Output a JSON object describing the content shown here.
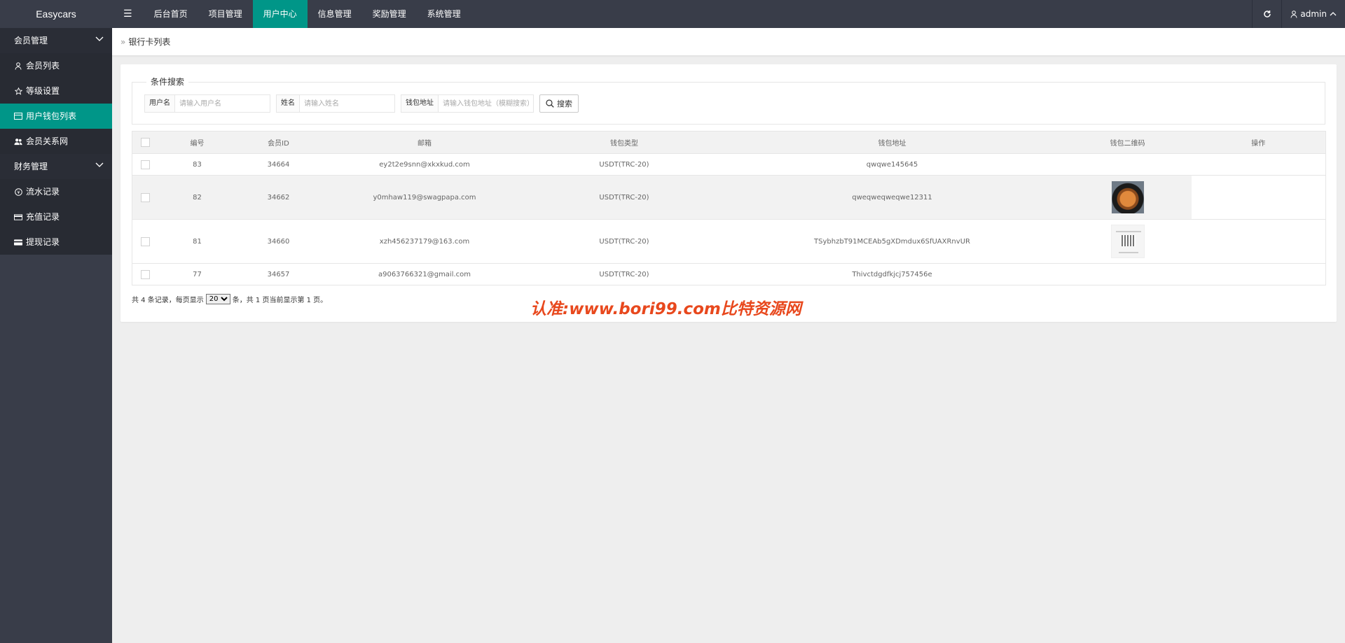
{
  "app": {
    "title": "Easycars"
  },
  "topnav": {
    "toggle": "☰",
    "items": [
      {
        "label": "后台首页"
      },
      {
        "label": "项目管理"
      },
      {
        "label": "用户中心",
        "active": true
      },
      {
        "label": "信息管理"
      },
      {
        "label": "奖励管理"
      },
      {
        "label": "系统管理"
      }
    ],
    "user": "admin"
  },
  "sidebar": {
    "group1": {
      "label": "会员管理"
    },
    "items1": [
      {
        "label": "会员列表",
        "icon": "user-icon"
      },
      {
        "label": "等级设置",
        "icon": "star-icon"
      },
      {
        "label": "用户钱包列表",
        "icon": "card-icon",
        "active": true
      },
      {
        "label": "会员关系网",
        "icon": "users-icon"
      }
    ],
    "group2": {
      "label": "财务管理"
    },
    "items2": [
      {
        "label": "流水记录",
        "icon": "coin-icon"
      },
      {
        "label": "充值记录",
        "icon": "card-icon"
      },
      {
        "label": "提现记录",
        "icon": "card-icon"
      }
    ]
  },
  "breadcrumb": {
    "sep": "»",
    "current": "银行卡列表"
  },
  "search": {
    "legend": "条件搜索",
    "username": {
      "label": "用户名",
      "placeholder": "请输入用户名"
    },
    "name": {
      "label": "姓名",
      "placeholder": "请输入姓名"
    },
    "wallet": {
      "label": "钱包地址",
      "placeholder": "请输入钱包地址（模糊搜索）"
    },
    "button": "搜索"
  },
  "table": {
    "headers": [
      "编号",
      "会员ID",
      "邮箱",
      "钱包类型",
      "钱包地址",
      "钱包二维码",
      "操作"
    ],
    "rows": [
      {
        "id": "83",
        "member_id": "34664",
        "email": "ey2t2e9snn@xkxkud.com",
        "type": "USDT(TRC-20)",
        "address": "qwqwe145645",
        "qr": ""
      },
      {
        "id": "82",
        "member_id": "34662",
        "email": "y0mhaw119@swagpapa.com",
        "type": "USDT(TRC-20)",
        "address": "qweqweqweqwe12311",
        "qr": "food"
      },
      {
        "id": "81",
        "member_id": "34660",
        "email": "xzh456237179@163.com",
        "type": "USDT(TRC-20)",
        "address": "TSybhzbT91MCEAb5gXDmdux6SfUAXRnvUR",
        "qr": "qr"
      },
      {
        "id": "77",
        "member_id": "34657",
        "email": "a9063766321@gmail.com",
        "type": "USDT(TRC-20)",
        "address": "Thivctdgdfkjcj757456e",
        "qr": ""
      }
    ]
  },
  "pager": {
    "prefix": "共 4 条记录，每页显示",
    "page_size": "20",
    "suffix": "条，共 1 页当前显示第 1 页。"
  },
  "watermark": "认准:www.bori99.com比特资源网",
  "colors": {
    "header": "#393d49",
    "accent": "#009688",
    "watermark": "#e8481d"
  }
}
